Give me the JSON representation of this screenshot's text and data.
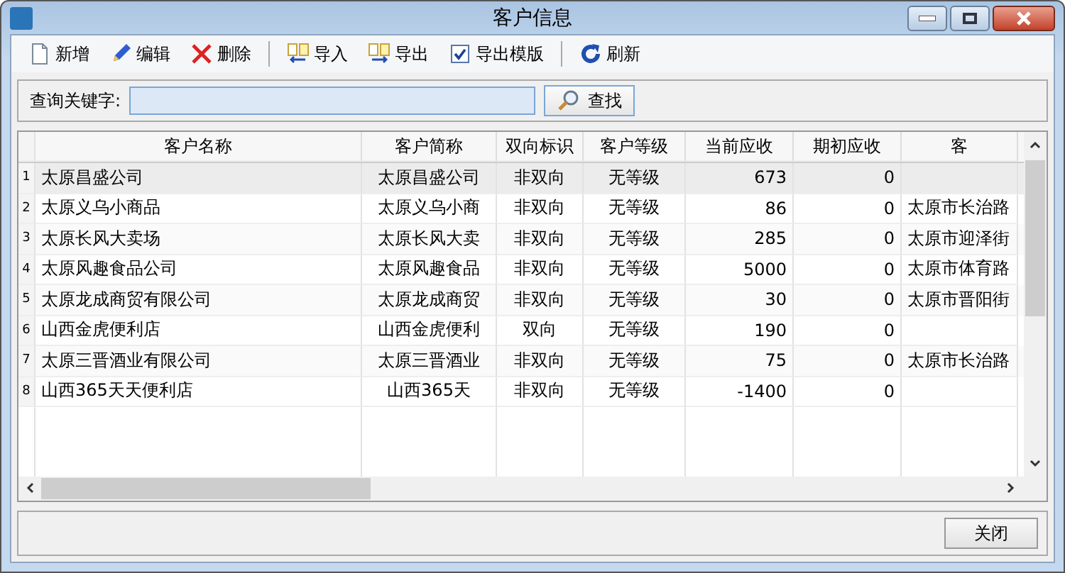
{
  "window": {
    "title": "客户信息"
  },
  "toolbar": [
    {
      "label": "新增",
      "kind": "new"
    },
    {
      "label": "编辑",
      "kind": "edit"
    },
    {
      "label": "删除",
      "kind": "delete"
    },
    {
      "label": "导入",
      "kind": "import"
    },
    {
      "label": "导出",
      "kind": "export"
    },
    {
      "label": "导出模版",
      "kind": "template"
    },
    {
      "label": "刷新",
      "kind": "refresh"
    }
  ],
  "search": {
    "label": "查询关键字:",
    "button": "查找"
  },
  "table": {
    "columns": [
      "客户名称",
      "客户简称",
      "双向标识",
      "客户等级",
      "当前应收",
      "期初应收",
      "客"
    ],
    "rows": [
      {
        "number": "1",
        "selected": true,
        "cells": [
          "太原昌盛公司",
          "太原昌盛公司",
          "非双向",
          "无等级",
          "673",
          "0",
          ""
        ]
      },
      {
        "number": "2",
        "selected": false,
        "cells": [
          "太原义乌小商品",
          "太原义乌小商",
          "非双向",
          "无等级",
          "86",
          "0",
          "太原市长治路"
        ]
      },
      {
        "number": "3",
        "selected": false,
        "cells": [
          "太原长风大卖场",
          "太原长风大卖",
          "非双向",
          "无等级",
          "285",
          "0",
          "太原市迎泽街"
        ]
      },
      {
        "number": "4",
        "selected": false,
        "cells": [
          "太原风趣食品公司",
          "太原风趣食品",
          "非双向",
          "无等级",
          "5000",
          "0",
          "太原市体育路"
        ]
      },
      {
        "number": "5",
        "selected": false,
        "cells": [
          "太原龙成商贸有限公司",
          "太原龙成商贸",
          "非双向",
          "无等级",
          "30",
          "0",
          "太原市晋阳街"
        ]
      },
      {
        "number": "6",
        "selected": false,
        "cells": [
          "山西金虎便利店",
          "山西金虎便利",
          "双向",
          "无等级",
          "190",
          "0",
          ""
        ]
      },
      {
        "number": "7",
        "selected": false,
        "cells": [
          "太原三晋酒业有限公司",
          "太原三晋酒业",
          "非双向",
          "无等级",
          "75",
          "0",
          "太原市长治路"
        ]
      },
      {
        "number": "8",
        "selected": false,
        "cells": [
          "山西365天天便利店",
          "山西365天",
          "非双向",
          "无等级",
          "-1400",
          "0",
          ""
        ]
      }
    ]
  },
  "footer": {
    "button": "关闭"
  }
}
